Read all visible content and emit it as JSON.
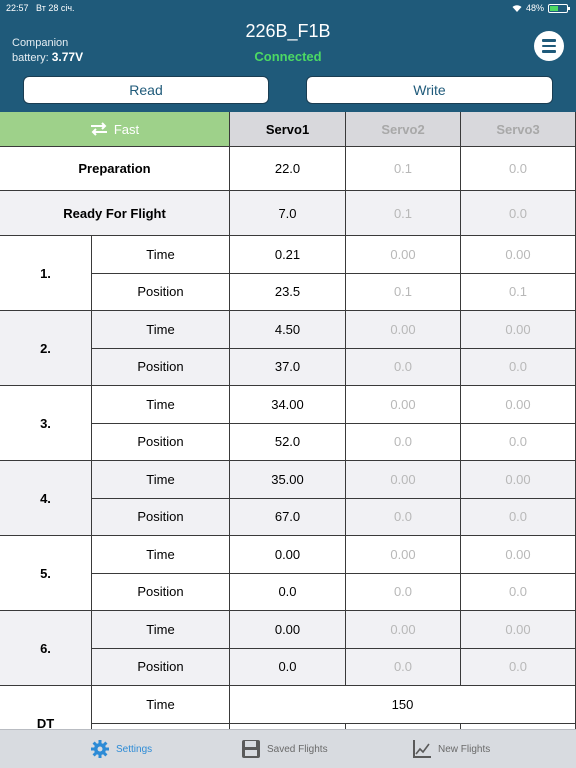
{
  "status_bar": {
    "time": "22:57",
    "date": "Вт 28 січ.",
    "battery_percent": "48%"
  },
  "header": {
    "companion_label_line1": "Companion",
    "companion_label_line2": "battery:",
    "companion_voltage": "3.77V",
    "device_name": "226B_F1B",
    "connection_status": "Connected",
    "read_label": "Read",
    "write_label": "Write"
  },
  "table": {
    "fast_label": "Fast",
    "servo_headers": [
      "Servo1",
      "Servo2",
      "Servo3"
    ],
    "preparation": {
      "label": "Preparation",
      "values": [
        "22.0",
        "0.1",
        "0.0"
      ]
    },
    "ready": {
      "label": "Ready For Flight",
      "values": [
        "7.0",
        "0.1",
        "0.0"
      ]
    },
    "time_label": "Time",
    "position_label": "Position",
    "steps": [
      {
        "label": "1.",
        "time": [
          "0.21",
          "0.00",
          "0.00"
        ],
        "position": [
          "23.5",
          "0.1",
          "0.1"
        ]
      },
      {
        "label": "2.",
        "time": [
          "4.50",
          "0.00",
          "0.00"
        ],
        "position": [
          "37.0",
          "0.0",
          "0.0"
        ]
      },
      {
        "label": "3.",
        "time": [
          "34.00",
          "0.00",
          "0.00"
        ],
        "position": [
          "52.0",
          "0.0",
          "0.0"
        ]
      },
      {
        "label": "4.",
        "time": [
          "35.00",
          "0.00",
          "0.00"
        ],
        "position": [
          "67.0",
          "0.0",
          "0.0"
        ]
      },
      {
        "label": "5.",
        "time": [
          "0.00",
          "0.00",
          "0.00"
        ],
        "position": [
          "0.0",
          "0.0",
          "0.0"
        ]
      },
      {
        "label": "6.",
        "time": [
          "0.00",
          "0.00",
          "0.00"
        ],
        "position": [
          "0.0",
          "0.0",
          "0.0"
        ]
      }
    ],
    "dt": {
      "label": "DT",
      "time": "150"
    }
  },
  "tabs": [
    {
      "label": "Settings",
      "icon": "gear-icon",
      "active": true
    },
    {
      "label": "Saved Flights",
      "icon": "save-icon",
      "active": false
    },
    {
      "label": "New Flights",
      "icon": "chart-icon",
      "active": false
    }
  ],
  "colors": {
    "header_bg": "#1f5a7a",
    "connected": "#4cd964",
    "fast_bg": "#9ed18a",
    "active_tab": "#2d8bd6"
  }
}
